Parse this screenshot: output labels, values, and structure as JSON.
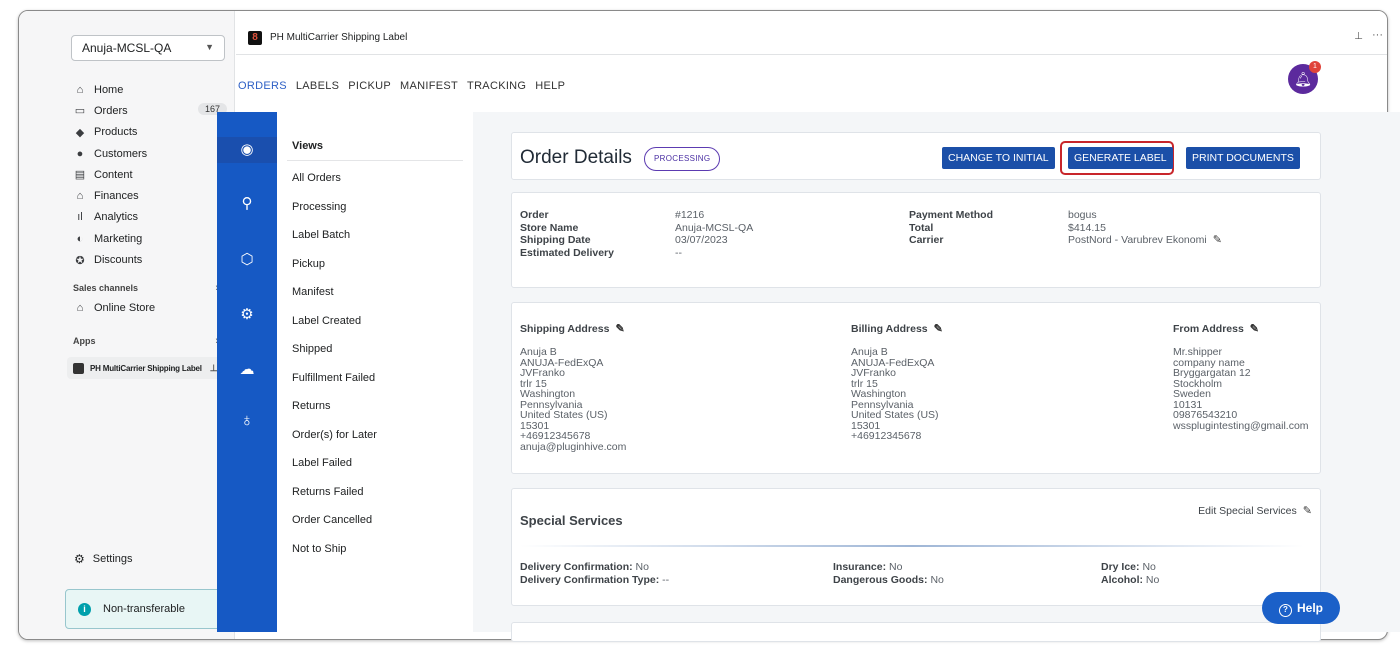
{
  "sidebar": {
    "store": "Anuja-MCSL-QA",
    "items": [
      {
        "icon": "home-icon",
        "glyph": "⌂",
        "label": "Home"
      },
      {
        "icon": "orders-icon",
        "glyph": "▭",
        "label": "Orders",
        "badge": "167"
      },
      {
        "icon": "tag-icon",
        "glyph": "◆",
        "label": "Products"
      },
      {
        "icon": "person-icon",
        "glyph": "●",
        "label": "Customers"
      },
      {
        "icon": "content-icon",
        "glyph": "▤",
        "label": "Content"
      },
      {
        "icon": "bank-icon",
        "glyph": "⌂",
        "label": "Finances"
      },
      {
        "icon": "bar-chart-icon",
        "glyph": "ıl",
        "label": "Analytics"
      },
      {
        "icon": "megaphone-icon",
        "glyph": "◐",
        "label": "Marketing"
      },
      {
        "icon": "discount-icon",
        "glyph": "✪",
        "label": "Discounts"
      }
    ],
    "sales_channels_label": "Sales channels",
    "online_store": "Online Store",
    "apps_label": "Apps",
    "app_item": "PH MultiCarrier Shipping Label",
    "settings": "Settings",
    "non_transferable": "Non-transferable"
  },
  "header": {
    "app_title": "PH MultiCarrier Shipping Label"
  },
  "topnav": [
    "ORDERS",
    "LABELS",
    "PICKUP",
    "MANIFEST",
    "TRACKING",
    "HELP"
  ],
  "notification_count": "1",
  "views": {
    "title": "Views",
    "items": [
      "All Orders",
      "Processing",
      "Label Batch",
      "Pickup",
      "Manifest",
      "Label Created",
      "Shipped",
      "Fulfillment Failed",
      "Returns",
      "Order(s) for Later",
      "Label Failed",
      "Returns Failed",
      "Order Cancelled",
      "Not to Ship"
    ]
  },
  "order": {
    "title": "Order Details",
    "status": "PROCESSING",
    "buttons": {
      "change_initial": "CHANGE TO INITIAL",
      "generate_label": "GENERATE LABEL",
      "print_documents": "PRINT DOCUMENTS"
    },
    "fields_left": [
      {
        "k": "Order",
        "v": "#1216"
      },
      {
        "k": "Store Name",
        "v": "Anuja-MCSL-QA"
      },
      {
        "k": "Shipping Date",
        "v": "03/07/2023"
      },
      {
        "k": "Estimated Delivery",
        "v": "--"
      }
    ],
    "fields_right": [
      {
        "k": "Payment Method",
        "v": "bogus"
      },
      {
        "k": "Total",
        "v": "$414.15"
      },
      {
        "k": "Carrier",
        "v": "PostNord - Varubrev Ekonomi"
      }
    ]
  },
  "addresses": {
    "shipping": {
      "heading": "Shipping Address",
      "lines": [
        "Anuja B",
        "ANUJA-FedExQA",
        "JVFranko",
        "trlr 15",
        "Washington",
        "Pennsylvania",
        "United States (US)",
        "15301",
        "+46912345678",
        "anuja@pluginhive.com"
      ]
    },
    "billing": {
      "heading": "Billing Address",
      "lines": [
        "Anuja B",
        "ANUJA-FedExQA",
        "JVFranko",
        "trlr 15",
        "Washington",
        "Pennsylvania",
        "United States (US)",
        "15301",
        "+46912345678"
      ]
    },
    "from": {
      "heading": "From Address",
      "lines": [
        "Mr.shipper",
        "company name",
        "Bryggargatan 12",
        "Stockholm",
        "Sweden",
        "10131",
        "09876543210",
        "wssplugintesting@gmail.com"
      ]
    }
  },
  "special_services": {
    "title": "Special Services",
    "edit": "Edit Special Services",
    "items": [
      {
        "k": "Delivery Confirmation:",
        "v": "No"
      },
      {
        "k": "Delivery Confirmation Type:",
        "v": "--"
      },
      {
        "k": "Insurance:",
        "v": "No"
      },
      {
        "k": "Dangerous Goods:",
        "v": "No"
      },
      {
        "k": "Dry Ice:",
        "v": "No"
      },
      {
        "k": "Alcohol:",
        "v": "No"
      }
    ]
  },
  "help_button": "Help",
  "colors": {
    "primary": "#1b4fa8",
    "iconbar": "#1659c4",
    "highlight": "#c8262b",
    "status": "#5c3bb1"
  }
}
